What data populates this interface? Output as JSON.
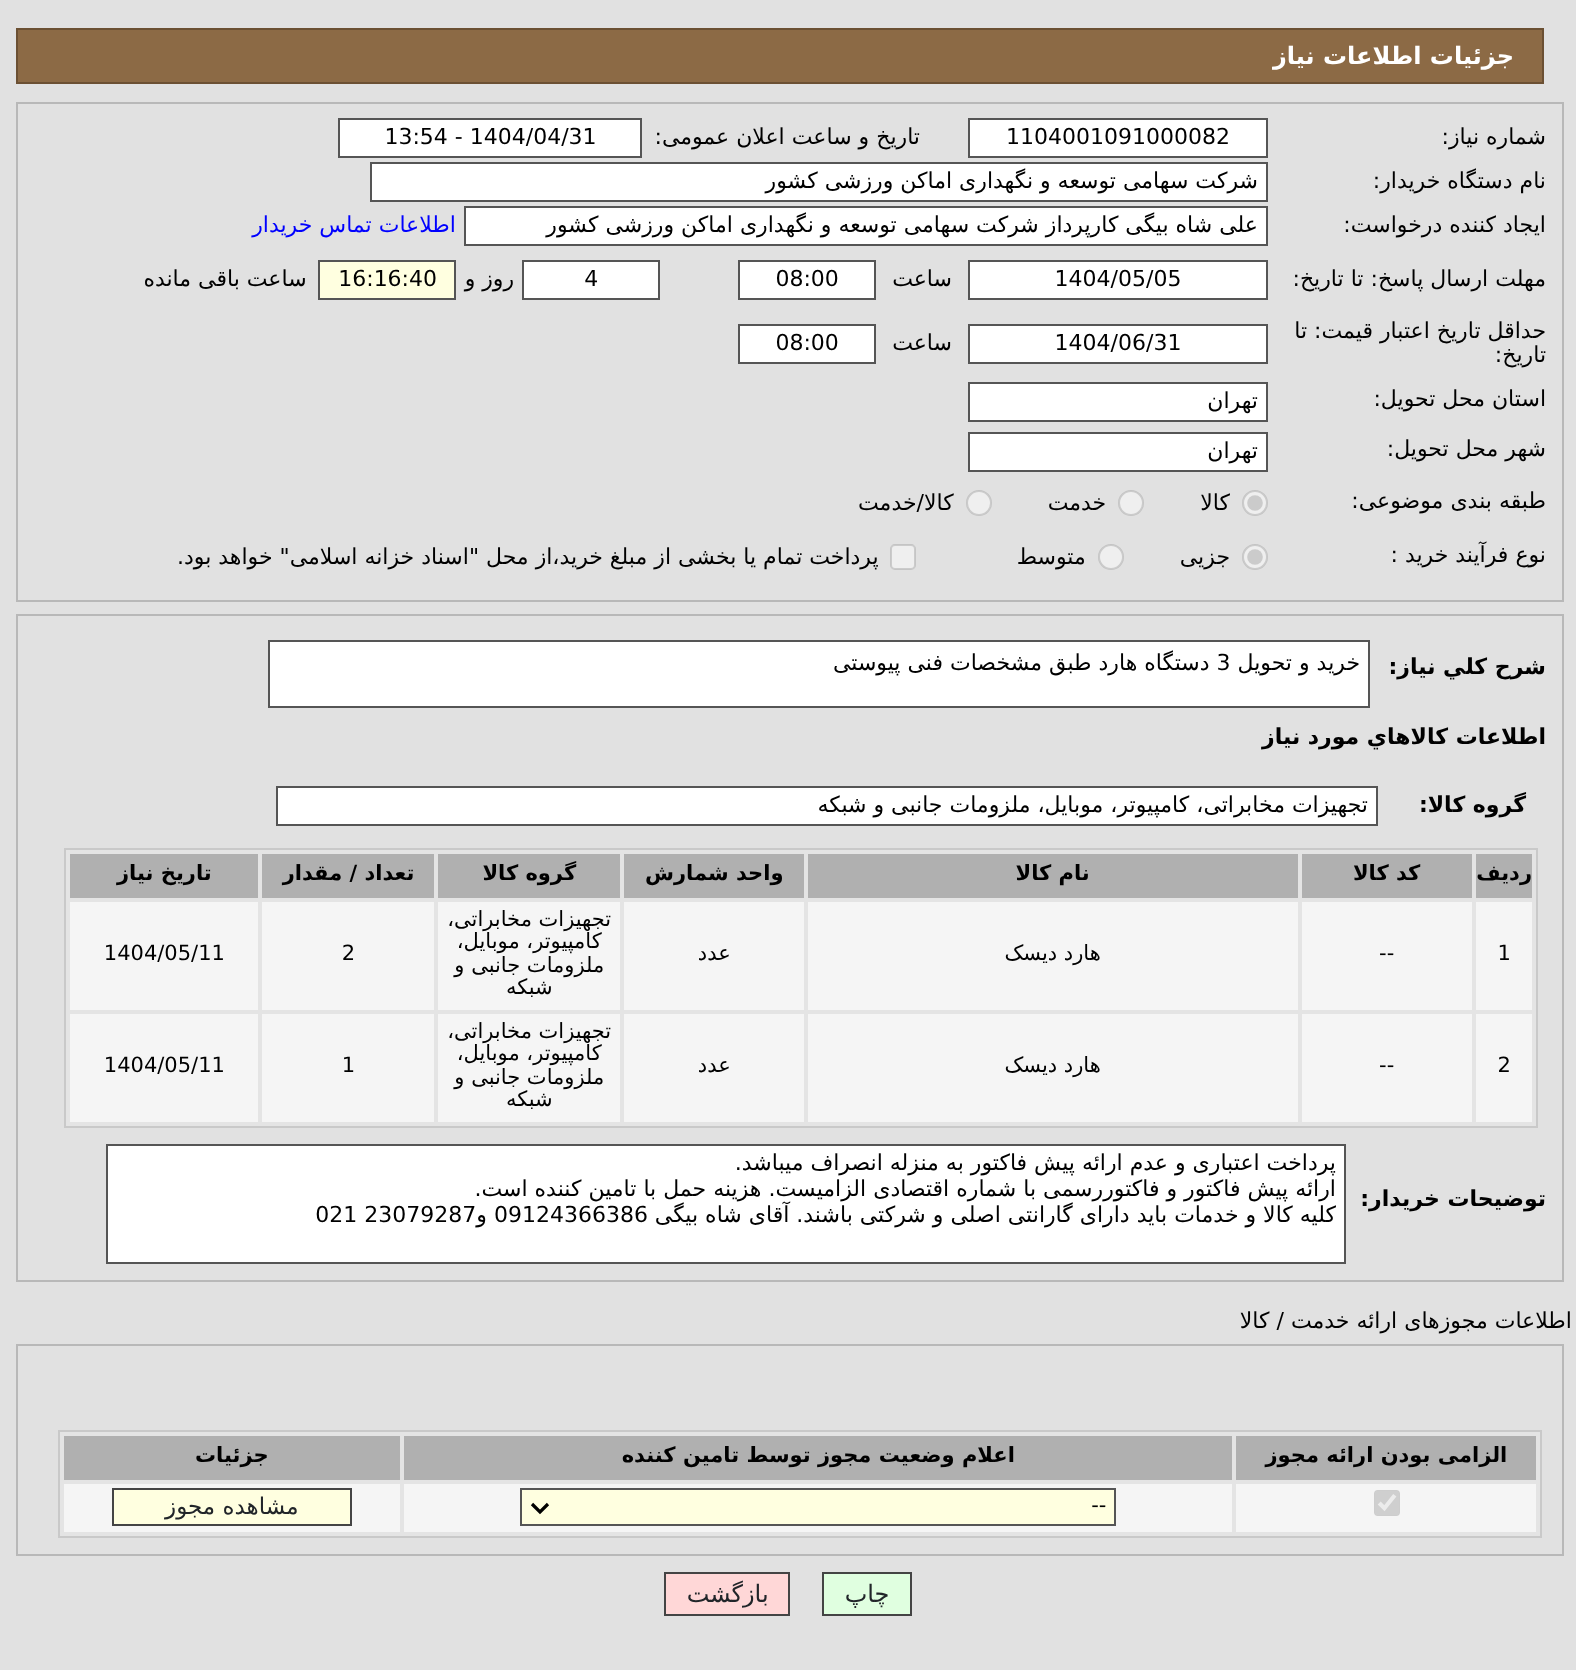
{
  "header": {
    "title": "جزئیات اطلاعات نیاز"
  },
  "need_number": {
    "label": "شماره نیاز:",
    "value": "1104001091000082"
  },
  "announce": {
    "label": "تاریخ و ساعت اعلان عمومی:",
    "value": "1404/04/31 - 13:54"
  },
  "buyer": {
    "label": "نام دستگاه خریدار:",
    "value": "شرکت سهامی توسعه و نگهداری اماکن ورزشی کشور"
  },
  "requester": {
    "label": "ایجاد کننده درخواست:",
    "value": "علی شاه بیگی کارپرداز شرکت سهامی توسعه و نگهداری اماکن ورزشی کشور",
    "link": "اطلاعات تماس خریدار"
  },
  "deadline": {
    "label": "مهلت ارسال پاسخ: تا تاریخ:",
    "date": "1404/05/05",
    "time_label": "ساعت",
    "time": "08:00",
    "days": "4",
    "days_label": "روز و",
    "remaining": "16:16:40",
    "remaining_label": "ساعت باقی مانده"
  },
  "validity": {
    "label": "حداقل تاریخ اعتبار قیمت: تا تاریخ:",
    "date": "1404/06/31",
    "time_label": "ساعت",
    "time": "08:00"
  },
  "province": {
    "label": "استان محل تحویل:",
    "value": "تهران"
  },
  "city": {
    "label": "شهر محل تحویل:",
    "value": "تهران"
  },
  "category": {
    "label": "طبقه بندی موضوعی:",
    "options": [
      {
        "label": "کالا",
        "selected": true
      },
      {
        "label": "خدمت",
        "selected": false
      },
      {
        "label": "کالا/خدمت",
        "selected": false
      }
    ]
  },
  "process": {
    "label": "نوع فرآیند خرید :",
    "options": [
      {
        "label": "جزیی",
        "selected": true
      },
      {
        "label": "متوسط",
        "selected": false
      }
    ],
    "payment": {
      "checked": false,
      "text": "پرداخت تمام یا بخشی از مبلغ خرید،از محل \"اسناد خزانه اسلامی\" خواهد بود."
    }
  },
  "description": {
    "label": "شرح كلي نياز:",
    "value": "خرید و تحویل 3 دستگاه هارد طبق مشخصات فنی پیوستی"
  },
  "goods": {
    "title": "اطلاعات كالاهاي مورد نياز",
    "group_label": "گروه کالا:",
    "group_value": "تجهیزات مخابراتی، کامپیوتر، موبایل، ملزومات جانبی و شبکه",
    "columns": [
      "ردیف",
      "کد کالا",
      "نام کالا",
      "واحد شمارش",
      "گروه کالا",
      "تعداد / مقدار",
      "تاریخ نیاز"
    ],
    "rows": [
      [
        "1",
        "--",
        "هارد دیسک",
        "عدد",
        "تجهیزات مخابراتی، کامپیوتر، موبایل، ملزومات جانبی و شبکه",
        "2",
        "1404/05/11"
      ],
      [
        "2",
        "--",
        "هارد دیسک",
        "عدد",
        "تجهیزات مخابراتی، کامپیوتر، موبایل، ملزومات جانبی و شبکه",
        "1",
        "1404/05/11"
      ]
    ]
  },
  "buyer_notes": {
    "label": "توضیحات خریدار:",
    "lines": [
      "پرداخت اعتباری و عدم ارائه پیش فاکتور به منزله انصراف میباشد.",
      "ارائه پیش فاکتور و فاکتوررسمی با شماره اقتصادی الزامیست. هزینه حمل با تامین کننده است.",
      "کلیه کالا و خدمات باید دارای گارانتی اصلی و شرکتی باشند. آقای شاه بیگی 09124366386 و23079287 021"
    ]
  },
  "licenses": {
    "title": "اطلاعات مجوزهای ارائه خدمت / کالا",
    "columns": [
      "الزامی بودن ارائه مجوز",
      "اعلام وضعیت مجوز توسط تامین کننده",
      "جزئیات"
    ],
    "rows": [
      {
        "required": true,
        "status": "--",
        "button": "مشاهده مجوز"
      }
    ]
  },
  "buttons": [
    {
      "kind": "print",
      "label": "چاپ"
    },
    {
      "kind": "back",
      "label": "بازگشت"
    }
  ]
}
